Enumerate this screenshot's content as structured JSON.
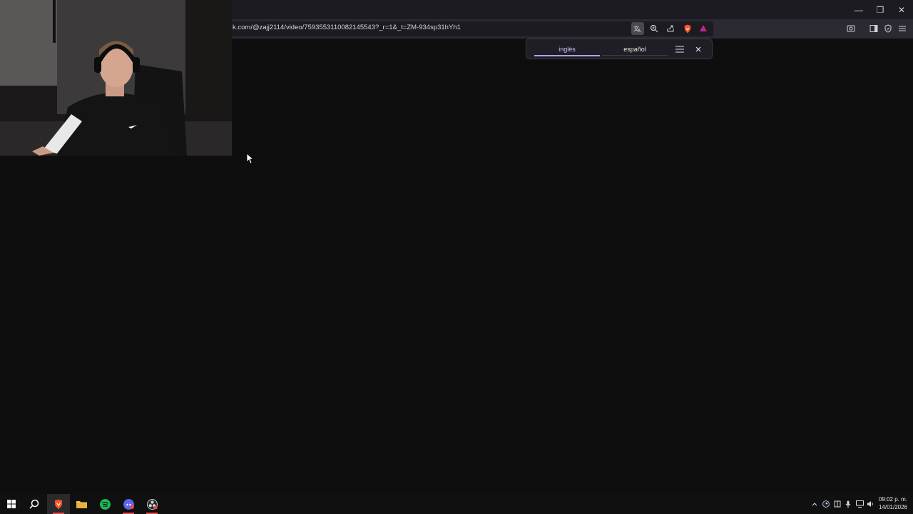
{
  "browser": {
    "url": "k.com/@zajj2114/video/7593553110082145543?_r=1&_t=ZM-934sp31hYh1",
    "window_controls": {
      "minimize": "—",
      "maximize": "❐",
      "close": "✕"
    }
  },
  "translate_popup": {
    "source_language": "inglés",
    "target_language": "español"
  },
  "taskbar": {
    "time": "09:02 p. m.",
    "date": "14/01/2026"
  },
  "colors": {
    "accent": "#a8a3ff",
    "page_bg": "#0f0e0f",
    "toolbar_bg": "#2b2a33",
    "brave_orange": "#fb542b",
    "spotify_green": "#1db954"
  }
}
